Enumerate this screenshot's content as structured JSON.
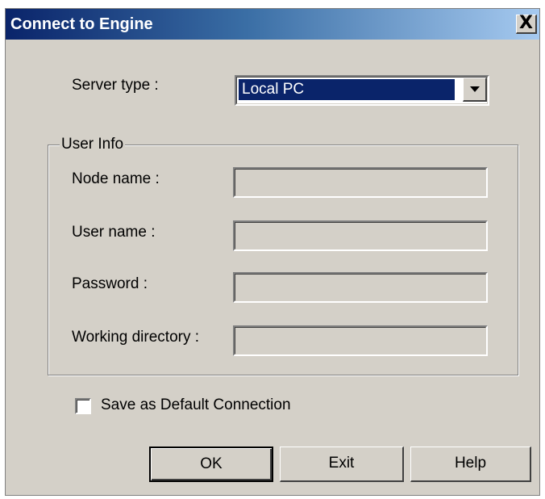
{
  "window": {
    "title": "Connect to Engine",
    "close_glyph": "X"
  },
  "server": {
    "label": "Server type :",
    "selected": "Local PC"
  },
  "user_info": {
    "legend": "User Info",
    "fields": [
      {
        "label": "Node name :",
        "value": ""
      },
      {
        "label": "User name :",
        "value": ""
      },
      {
        "label": "Password :",
        "value": ""
      },
      {
        "label": "Working directory :",
        "value": ""
      }
    ]
  },
  "save_default": {
    "label": "Save as Default Connection",
    "checked": false
  },
  "buttons": {
    "ok": "OK",
    "exit": "Exit",
    "help": "Help"
  },
  "colors": {
    "titlebar_start": "#0a246a",
    "titlebar_end": "#a6caf0",
    "dialog_face": "#d4d0c8",
    "selection": "#0a246a"
  }
}
